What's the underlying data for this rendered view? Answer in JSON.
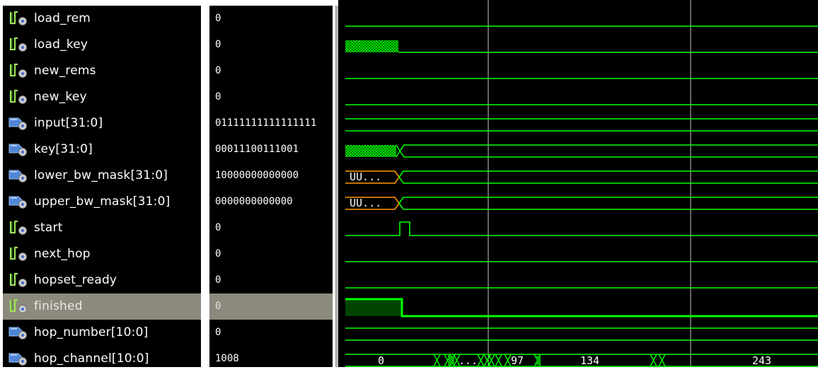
{
  "signals": [
    {
      "name": "load_rem",
      "value": "0",
      "kind": "bit",
      "icon": "bit-signal-icon"
    },
    {
      "name": "load_key",
      "value": "0",
      "kind": "bit",
      "icon": "bit-signal-icon"
    },
    {
      "name": "new_rems",
      "value": "0",
      "kind": "bit",
      "icon": "bit-signal-icon"
    },
    {
      "name": "new_key",
      "value": "0",
      "kind": "bit",
      "icon": "bit-signal-icon"
    },
    {
      "name": "input[31:0]",
      "value": "01111111111111111",
      "kind": "bus",
      "icon": "bus-signal-icon"
    },
    {
      "name": "key[31:0]",
      "value": "00011100111001",
      "kind": "bus",
      "icon": "bus-signal-icon"
    },
    {
      "name": "lower_bw_mask[31:0]",
      "value": "10000000000000",
      "kind": "bus",
      "icon": "bus-signal-icon"
    },
    {
      "name": "upper_bw_mask[31:0]",
      "value": "0000000000000",
      "kind": "bus",
      "icon": "bus-signal-icon"
    },
    {
      "name": "start",
      "value": "0",
      "kind": "bit",
      "icon": "bit-signal-icon"
    },
    {
      "name": "next_hop",
      "value": "0",
      "kind": "bit",
      "icon": "bit-signal-icon"
    },
    {
      "name": "hopset_ready",
      "value": "0",
      "kind": "bit",
      "icon": "bit-signal-icon"
    },
    {
      "name": "finished",
      "value": "0",
      "kind": "bit",
      "icon": "bit-signal-icon",
      "selected": true
    },
    {
      "name": "hop_number[10:0]",
      "value": "0",
      "kind": "bus",
      "icon": "bus-signal-icon"
    },
    {
      "name": "hop_channel[10:0]",
      "value": "1008",
      "kind": "bus",
      "icon": "bus-signal-icon"
    }
  ],
  "waveform": {
    "bus_labels": {
      "lower_bw_mask": "UU...",
      "upper_bw_mask": "UU...",
      "hop_channel": [
        "0",
        "...",
        "97",
        "134",
        "243"
      ]
    }
  },
  "colors": {
    "background": "#000000",
    "wave": "#00ff00",
    "undefined_wave": "#ff9900",
    "cursor": "#c8c8c8",
    "selected_row": "#8c8a7c",
    "text": "#ffffff"
  }
}
